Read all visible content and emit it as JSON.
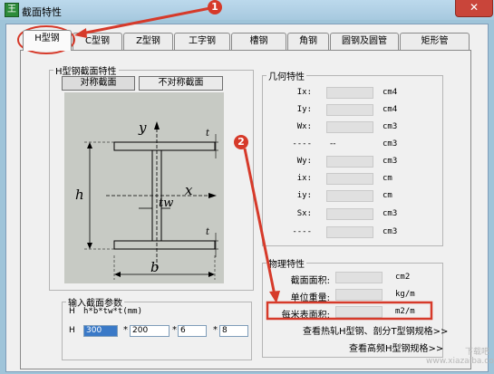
{
  "window": {
    "title": "截面特性",
    "app_icon_glyph": "王",
    "close_glyph": "✕"
  },
  "tabs": [
    "H型钢",
    "C型钢",
    "Z型钢",
    "工字钢",
    "槽钢",
    "角钢",
    "圆钢及圆管",
    "矩形管"
  ],
  "active_tab": "H型钢",
  "section_group": {
    "legend": "H型钢截面特性",
    "sym_button": "对称截面",
    "asym_button": "不对称截面",
    "diagram_labels": {
      "y": "y",
      "x": "x",
      "h": "h",
      "b": "b",
      "tw": "tw",
      "t_top": "t",
      "t_bottom": "t"
    }
  },
  "geometry": {
    "legend": "几何特性",
    "rows": [
      {
        "label": "Ix:",
        "value": "",
        "unit": "cm4"
      },
      {
        "label": "Iy:",
        "value": "",
        "unit": "cm4"
      },
      {
        "label": "Wx:",
        "value": "",
        "unit": "cm3"
      },
      {
        "label": "----",
        "value": "--",
        "unit": "cm3"
      },
      {
        "label": "Wy:",
        "value": "",
        "unit": "cm3"
      },
      {
        "label": "ix:",
        "value": "",
        "unit": "cm"
      },
      {
        "label": "iy:",
        "value": "",
        "unit": "cm"
      },
      {
        "label": "Sx:",
        "value": "",
        "unit": "cm3"
      },
      {
        "label": "----",
        "value": "",
        "unit": "cm3"
      }
    ]
  },
  "physical": {
    "legend": "物理特性",
    "rows": [
      {
        "label": "截面面积:",
        "value": "",
        "unit": "cm2"
      },
      {
        "label": "单位重量:",
        "value": "",
        "unit": "kg/m"
      },
      {
        "label": "每米表面积:",
        "value": "",
        "unit": "m2/m"
      }
    ],
    "links": [
      "查看热轧H型钢、剖分T型钢规格>>",
      "查看高频H型钢规格>>"
    ]
  },
  "input": {
    "legend": "输入截面参数",
    "row1_prefix": "H",
    "row1_hint": "h*b*tw*t(mm)",
    "row2_prefix": "H",
    "values": [
      "300",
      "200",
      "6",
      "8"
    ],
    "separator": "*"
  },
  "annotations": {
    "callout_1": "1",
    "callout_2": "2",
    "highlight_color": "#d63a2a"
  },
  "watermark": {
    "lines": [
      "下载吧",
      "www.xiazaiba.com"
    ]
  }
}
